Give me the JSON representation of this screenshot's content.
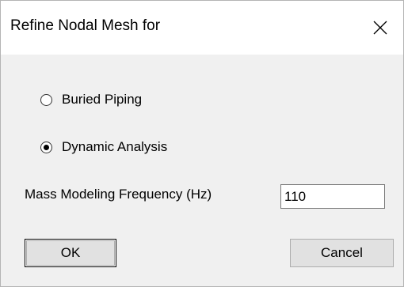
{
  "dialog": {
    "title": "Refine Nodal Mesh for",
    "close_icon": "close-icon"
  },
  "options": [
    {
      "label": "Buried Piping",
      "checked": false
    },
    {
      "label": "Dynamic Analysis",
      "checked": true
    }
  ],
  "mass_modeling": {
    "label": "Mass Modeling Frequency (Hz)",
    "value": "110"
  },
  "buttons": {
    "ok": "OK",
    "cancel": "Cancel"
  }
}
